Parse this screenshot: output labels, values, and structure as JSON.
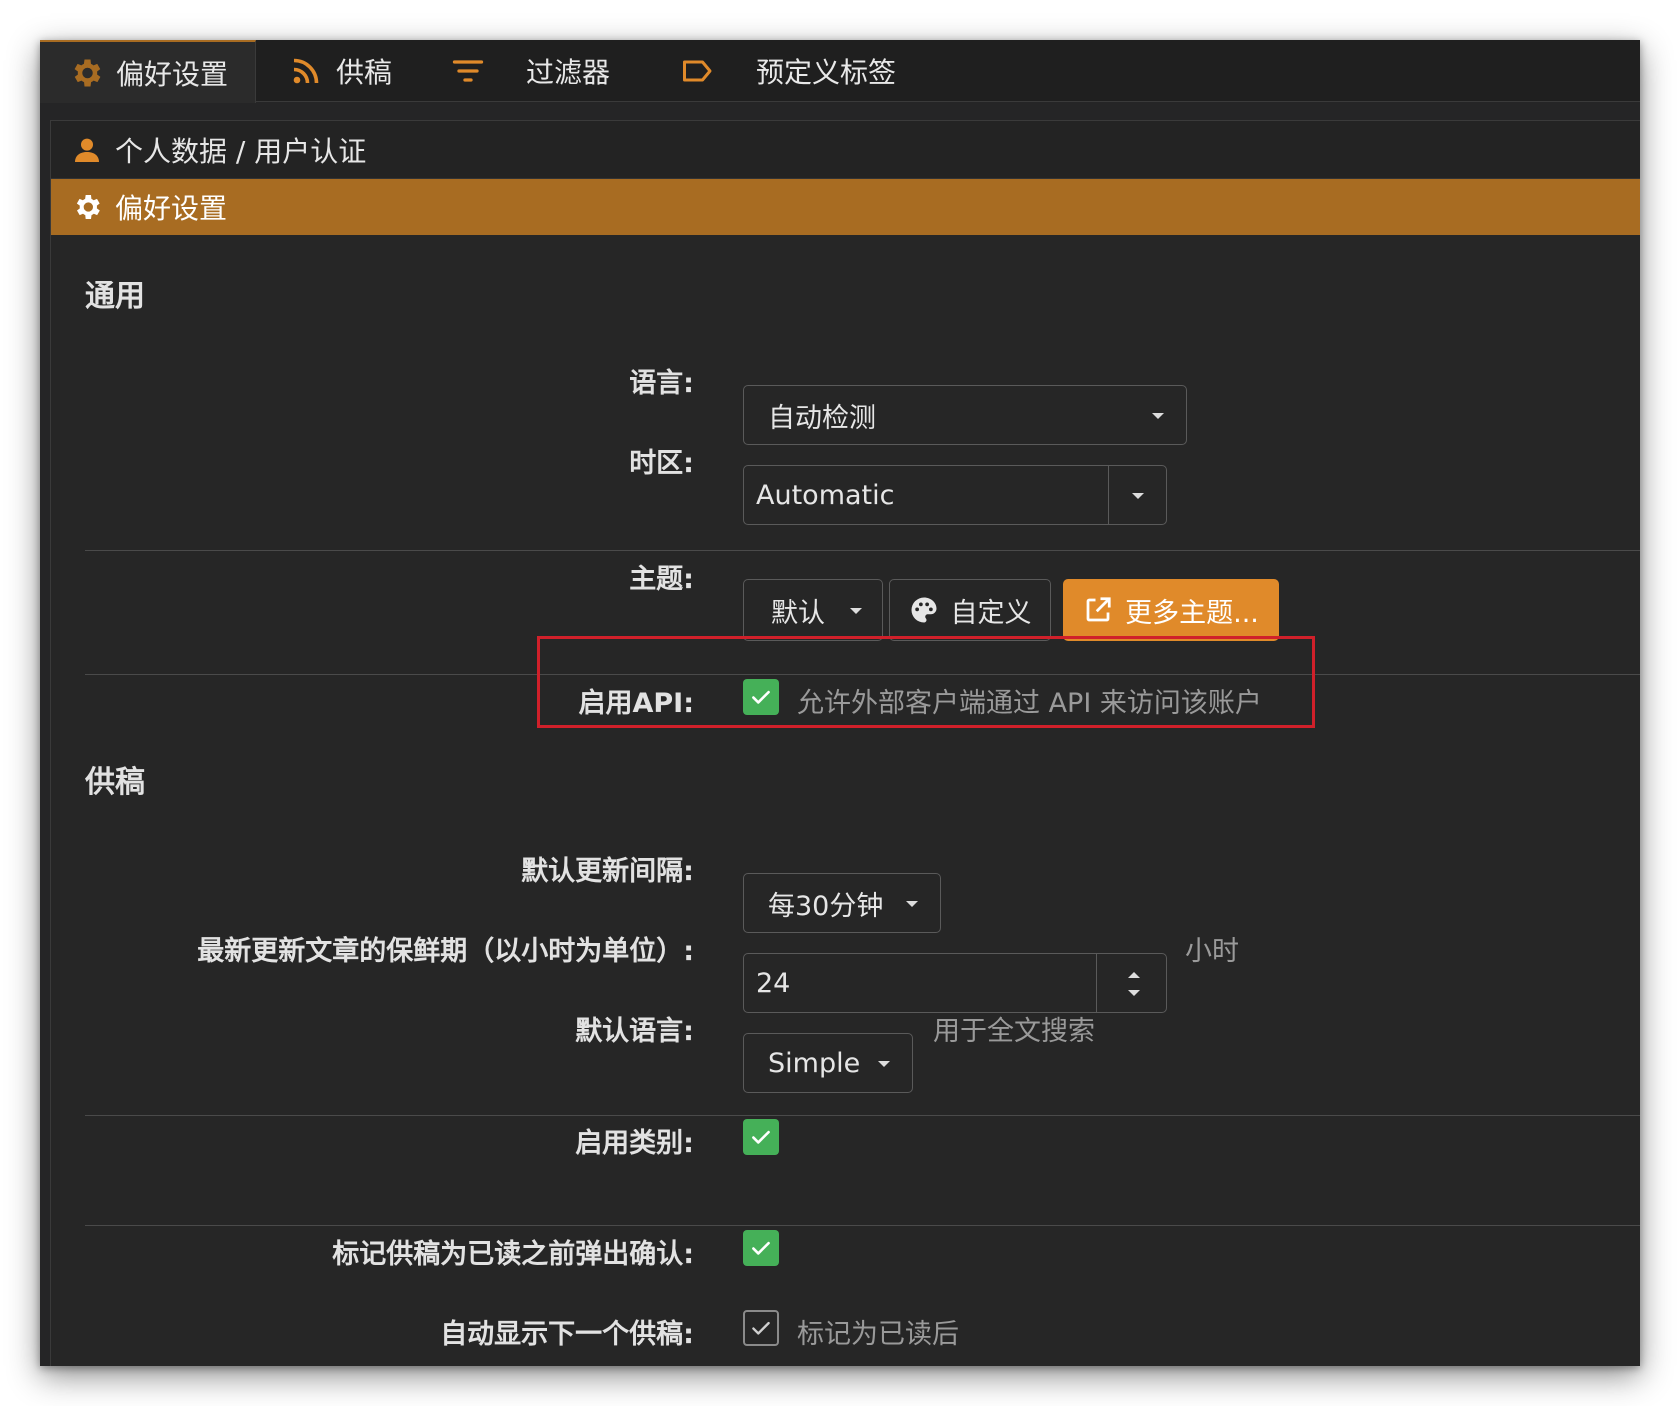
{
  "tabs": [
    {
      "label": "偏好设置",
      "icon": "gear-icon",
      "active": true
    },
    {
      "label": "供稿",
      "icon": "rss-icon",
      "active": false
    },
    {
      "label": "过滤器",
      "icon": "filter-icon",
      "active": false
    },
    {
      "label": "预定义标签",
      "icon": "tag-icon",
      "active": false
    }
  ],
  "accordion": {
    "profile_header": "个人数据 / 用户认证",
    "prefs_header": "偏好设置"
  },
  "general": {
    "title": "通用",
    "language_label": "语言:",
    "language_value": "自动检测",
    "timezone_label": "时区:",
    "timezone_value": "Automatic",
    "theme_label": "主题:",
    "theme_value": "默认",
    "customize_label": "自定义",
    "more_themes_label": "更多主题...",
    "api_label": "启用API:",
    "api_checked": true,
    "api_hint": "允许外部客户端通过 API 来访问该账户"
  },
  "feeds": {
    "title": "供稿",
    "update_interval_label": "默认更新间隔:",
    "update_interval_value": "每30分钟",
    "fresh_label": "最新更新文章的保鲜期（以小时为单位）:",
    "fresh_value": "24",
    "fresh_unit": "小时",
    "default_lang_label": "默认语言:",
    "default_lang_value": "Simple",
    "default_lang_hint": "用于全文搜索",
    "categories_label": "启用类别:",
    "categories_checked": true,
    "confirm_label": "标记供稿为已读之前弹出确认:",
    "confirm_checked": true,
    "auto_next_label": "自动显示下一个供稿:",
    "auto_next_checked": true,
    "auto_next_hint": "标记为已读后"
  },
  "colors": {
    "accent": "#a86c22",
    "primary_button": "#e08a2a",
    "checkbox_green": "#45b058",
    "highlight_red": "#d0202a",
    "background": "#252526"
  }
}
